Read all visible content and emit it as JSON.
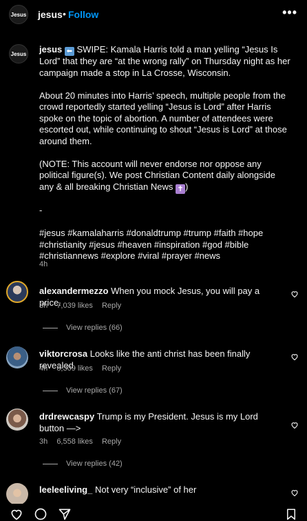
{
  "header": {
    "logo_text": "Jesus",
    "username": "jesus",
    "separator": "•",
    "follow_label": "Follow",
    "more_label": "•••"
  },
  "caption": {
    "username": "jesus",
    "arrow_glyph": "⬅",
    "line1": "SWIPE: Kamala Harris told a man yelling “Jesus Is Lord” that they are “at the wrong rally” on Thursday night as her campaign made a stop in La Crosse, Wisconsin.",
    "para2": "About 20 minutes into Harris’ speech, multiple people from the crowd reportedly started yelling “Jesus is Lord” after Harris spoke on the topic of abortion. A number of attendees were escorted out, while continuing to shout “Jesus is Lord” at those around them.",
    "para3": "(NOTE: This account will never endorse nor oppose any political figure(s). We post Christian Content daily alongside any & all breaking Christian News",
    "cross_glyph": "✝",
    "para3_end": ")",
    "dash": "-",
    "hashtags": "#jesus #kamalaharris #donaldtrump #trump #faith #hope #christianity #jesus #heaven #inspiration #god #bible #christiannews #explore #viral #prayer #news",
    "time": "4h"
  },
  "comments": [
    {
      "username": "alexandermezzo",
      "text": "When you mock Jesus, you will pay a price.",
      "time": "3h",
      "likes": "7,039 likes",
      "reply": "Reply",
      "view_replies": "View replies (66)"
    },
    {
      "username": "viktorcrosa",
      "text": "Looks like the anti christ has been finally revealed.",
      "time": "4h",
      "likes": "8,309 likes",
      "reply": "Reply",
      "view_replies": "View replies (67)"
    },
    {
      "username": "drdrewcaspy",
      "text": "Trump is my President. Jesus is my Lord button —>",
      "time": "3h",
      "likes": "6,558 likes",
      "reply": "Reply",
      "view_replies": "View replies (42)"
    },
    {
      "username": "leeleeliving_",
      "text": "Not very “inclusive” of her"
    }
  ],
  "bottom_bar": {
    "icons": [
      "heart-icon",
      "comment-icon",
      "share-icon",
      "bookmark-icon"
    ]
  }
}
